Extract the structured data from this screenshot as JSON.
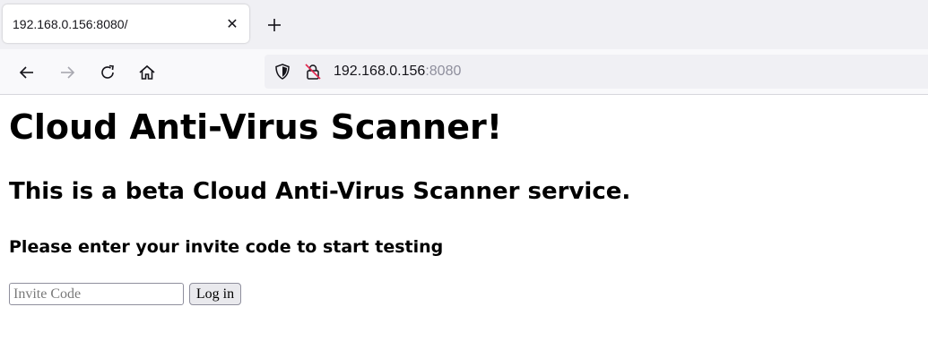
{
  "browser": {
    "tab": {
      "title": "192.168.0.156:8080/",
      "close_glyph": "✕"
    },
    "new_tab_glyph": "+",
    "url": {
      "host": "192.168.0.156",
      "port": ":8080"
    },
    "icons": {
      "back": "back-arrow-icon",
      "forward": "forward-arrow-icon",
      "reload": "reload-icon",
      "home": "home-icon",
      "tracking_protection": "shield-icon",
      "insecure_connection": "insecure-lock-icon"
    },
    "colors": {
      "insecure_slash": "#e22850",
      "toolbar_icon": "#15141a",
      "disabled_icon": "#a8a8b0",
      "url_port": "#8f8f9d"
    }
  },
  "page": {
    "title": "Cloud Anti-Virus Scanner!",
    "subtitle": "This is a beta Cloud Anti-Virus Scanner service.",
    "instructions": "Please enter your invite code to start testing",
    "invite_input": {
      "value": "",
      "placeholder": "Invite Code"
    },
    "login_button_label": "Log in"
  }
}
